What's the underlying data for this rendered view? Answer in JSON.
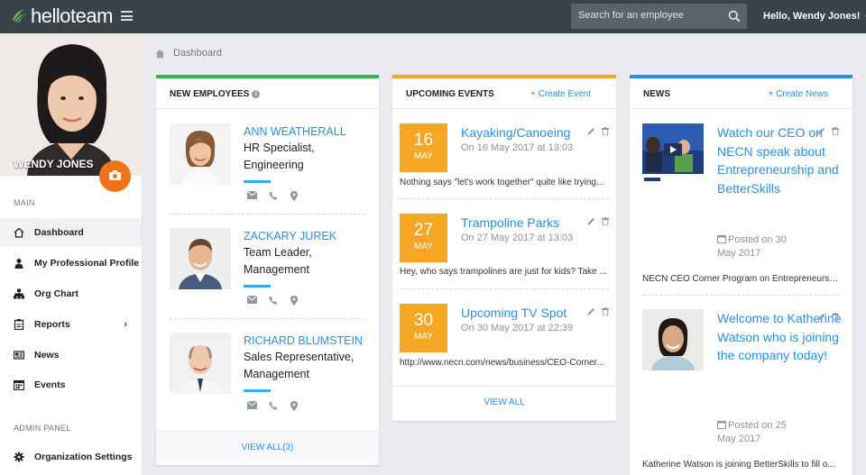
{
  "app": {
    "logo_text": "helloteam",
    "brand_color": "#6cc04a",
    "accent_color": "#2a8fe0",
    "orange": "#f0741c"
  },
  "search": {
    "placeholder": "Search for an employee"
  },
  "user_menu": {
    "label": "Hello, Wendy Jones!",
    "caret": "⌵"
  },
  "profile": {
    "name": "WENDY JONES"
  },
  "sidebar": {
    "main_label": "MAIN",
    "items": [
      {
        "label": "Dashboard",
        "icon": "home-icon",
        "active": true
      },
      {
        "label": "My Professional Profile",
        "icon": "user-icon"
      },
      {
        "label": "Org Chart",
        "icon": "org-chart-icon"
      },
      {
        "label": "Reports",
        "icon": "reports-icon",
        "has_submenu": true
      },
      {
        "label": "News",
        "icon": "news-icon"
      },
      {
        "label": "Events",
        "icon": "calendar-icon"
      }
    ],
    "admin_label": "ADMIN PANEL",
    "admin_items": [
      {
        "label": "Organization Settings",
        "icon": "gear-icon"
      }
    ]
  },
  "breadcrumb": {
    "current": "Dashboard"
  },
  "new_employees": {
    "title": "NEW EMPLOYEES",
    "accent": "#35b34a",
    "employees": [
      {
        "name": "ANN WEATHERALL",
        "role_line1": "HR Specialist,",
        "role_line2": "Engineering"
      },
      {
        "name": "ZACKARY JUREK",
        "role_line1": "Team Leader,",
        "role_line2": "Management"
      },
      {
        "name": "RICHARD BLUMSTEIN",
        "role_line1": "Sales Representative,",
        "role_line2": "Management"
      }
    ],
    "view_all": "VIEW ALL(3)"
  },
  "upcoming_events": {
    "title": "UPCOMING EVENTS",
    "action": "+ Create Event",
    "accent": "#f5a623",
    "events": [
      {
        "day": "16",
        "month": "MAY",
        "title": "Kayaking/Canoeing",
        "when": "On 16 May 2017 at 13:03",
        "desc": "Nothing says \"let's work together\" quite like trying..."
      },
      {
        "day": "27",
        "month": "MAY",
        "title": "Trampoline Parks",
        "when": "On 27 May 2017 at 13:03",
        "desc": "Hey, who says trampolines are just for kids? Take ..."
      },
      {
        "day": "30",
        "month": "MAY",
        "title": "Upcoming TV Spot",
        "when": "On 30 May 2017 at 22:39",
        "desc": "http://www.necn.com/news/business/CEO-Corner..."
      }
    ],
    "view_all": "VIEW ALL"
  },
  "news": {
    "title": "NEWS",
    "action": "+ Create News",
    "accent": "#2a8fe0",
    "items": [
      {
        "title": "Watch our CEO on NECN speak about Entrepreneurship and BetterSkills",
        "posted": "Posted on 30 May 2017",
        "desc": "NECN CEO Corner Program on Entrepreneursh..."
      },
      {
        "title": "Welcome to Katherine Watson who is joining the company today!",
        "posted": "Posted on 25 May 2017",
        "desc": "Katherine Watson is joining BetterSkills to fill o..."
      }
    ]
  }
}
